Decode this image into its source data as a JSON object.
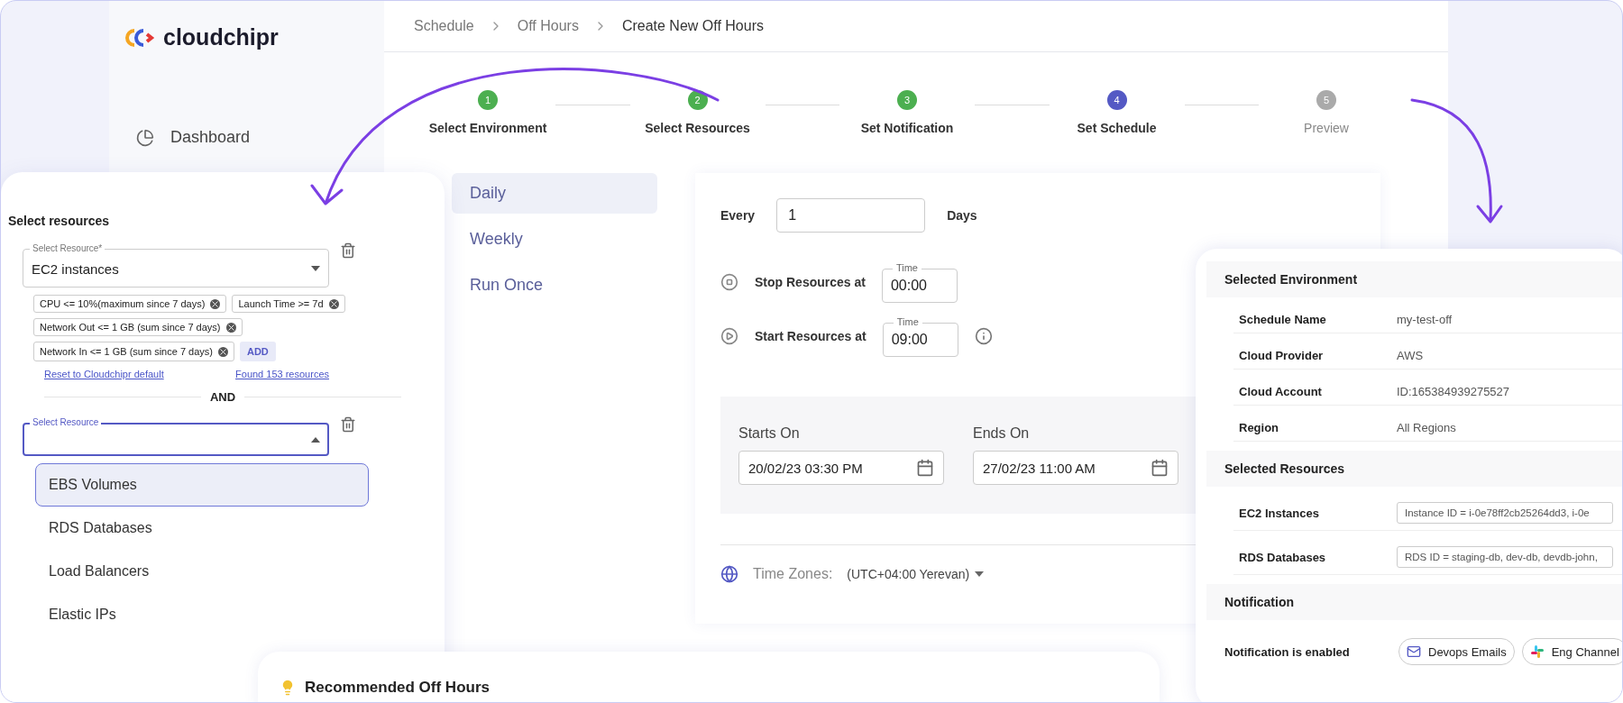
{
  "logo": {
    "text": "cloudchipr"
  },
  "sidebar": {
    "items": [
      {
        "label": "Dashboard",
        "selected": false
      }
    ]
  },
  "breadcrumb": [
    "Schedule",
    "Off Hours",
    "Create New Off Hours"
  ],
  "stepper": [
    {
      "number": "1",
      "label": "Select Environment",
      "kind": "done"
    },
    {
      "number": "2",
      "label": "Select Resources",
      "kind": "done"
    },
    {
      "number": "3",
      "label": "Set Notification",
      "kind": "done"
    },
    {
      "number": "4",
      "label": "Set Schedule",
      "kind": "active"
    },
    {
      "number": "5",
      "label": "Preview",
      "kind": "pending"
    }
  ],
  "schedule_tabs": [
    {
      "label": "Daily",
      "selected": true
    },
    {
      "label": "Weekly",
      "selected": false
    },
    {
      "label": "Run Once",
      "selected": false
    }
  ],
  "form": {
    "every": {
      "label": "Every",
      "value": "1",
      "unit": "Days"
    },
    "actions": [
      {
        "kind": "stop",
        "label": "Stop Resources at",
        "field_label": "Time",
        "value": "00:00",
        "info": false
      },
      {
        "kind": "start",
        "label": "Start Resources at",
        "field_label": "Time",
        "value": "09:00",
        "info": true
      }
    ],
    "dates": [
      {
        "label": "Starts On",
        "value": "20/02/23 03:30 PM"
      },
      {
        "label": "Ends On",
        "value": "27/02/23 11:00 AM"
      }
    ],
    "time_zone": {
      "label": "Time Zones:",
      "value": "(UTC+04:00 Yerevan)"
    }
  },
  "resource_card": {
    "title": "Select resources",
    "first_select": {
      "label": "Select Resource*",
      "value": "EC2 instances"
    },
    "filters": [
      "CPU <= 10%(maximum since 7 days)",
      "Launch Time >= 7d",
      "Network Out <= 1 GB (sum since 7 days)",
      "Network In <= 1 GB (sum since 7 days)"
    ],
    "add_button": "ADD",
    "found_link": "Found 153 resources",
    "reset_link": "Reset to Cloudchipr default",
    "separator": "AND",
    "second_select": {
      "label": "Select Resource",
      "expanded": true
    },
    "options": [
      {
        "label": "EBS Volumes",
        "selected": true
      },
      {
        "label": "RDS Databases",
        "selected": false
      },
      {
        "label": "Load Balancers",
        "selected": false
      },
      {
        "label": "Elastic IPs",
        "selected": false
      }
    ]
  },
  "recommended": {
    "title": "Recommended Off Hours"
  },
  "summary": {
    "sections": [
      {
        "kind": "table",
        "title": "Selected Environment",
        "rows": [
          {
            "label": "Schedule Name",
            "value": "my-test-off"
          },
          {
            "label": "Cloud Provider",
            "value": "AWS"
          },
          {
            "label": "Cloud Account",
            "value": "ID:165384939275527"
          },
          {
            "label": "Region",
            "value": "All Regions"
          }
        ]
      },
      {
        "kind": "fields",
        "title": "Selected Resources",
        "rows": [
          {
            "label": "EC2 Instances",
            "value": "Instance ID = i-0e78ff2cb25264dd3, i-0e"
          },
          {
            "label": "RDS Databases",
            "value": "RDS ID = staging-db, dev-db, devdb-john,"
          }
        ]
      },
      {
        "kind": "channels",
        "title": "Notification",
        "label": "Notification is enabled",
        "channels": [
          {
            "kind": "email",
            "label": "Devops Emails"
          },
          {
            "kind": "slack",
            "label": "Eng Channel"
          }
        ]
      }
    ]
  }
}
